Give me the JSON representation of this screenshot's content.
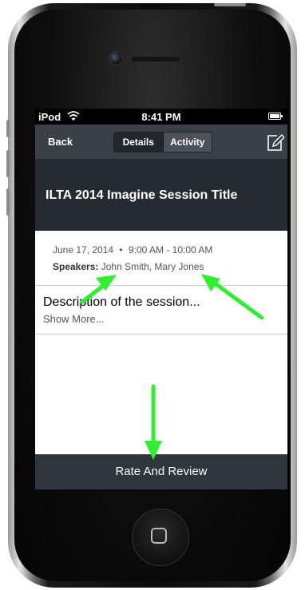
{
  "status_bar": {
    "carrier": "iPod",
    "time": "8:41 PM"
  },
  "navbar": {
    "back_label": "Back",
    "tabs": [
      {
        "label": "Details",
        "selected": true
      },
      {
        "label": "Activity",
        "selected": false
      }
    ],
    "compose_icon": "compose-icon"
  },
  "session": {
    "title": "ILTA 2014 Imagine Session Title",
    "date": "June 17, 2014",
    "separator": "•",
    "time_range": "9:00 AM - 10:00 AM",
    "speakers_label": "Speakers:",
    "speakers": "John Smith, Mary Jones",
    "description": "Description of the session...",
    "show_more": "Show More..."
  },
  "footer": {
    "rate_label": "Rate And Review"
  },
  "colors": {
    "navbar": "#3a4047",
    "title_header": "#262b31",
    "rate_bar": "#30363d",
    "annotation_arrow": "#2ef02e"
  },
  "annotations": {
    "arrow_icon": "green-arrow"
  }
}
